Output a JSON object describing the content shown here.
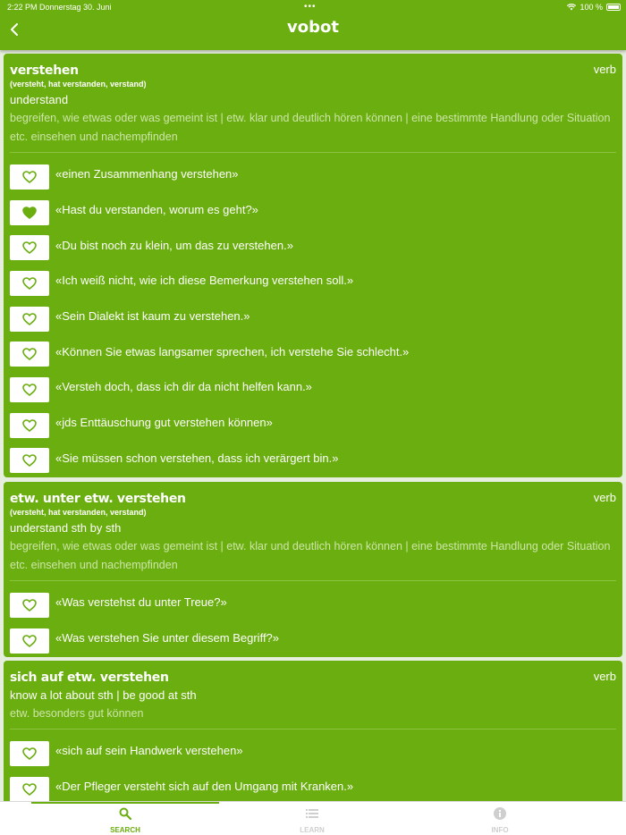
{
  "status": {
    "time": "2:22 PM",
    "date": "Donnerstag 30. Juni",
    "battery": "100 %"
  },
  "nav": {
    "title": "vobot"
  },
  "colors": {
    "accent": "#6aae0f",
    "definition": "#cde5a8",
    "tab_inactive": "#cfcfcf"
  },
  "entries": [
    {
      "word": "verstehen",
      "pos": "verb",
      "forms": "(versteht, hat verstanden, verstand)",
      "translation": "understand",
      "definition": "begreifen, wie etwas oder was gemeint ist | etw. klar und deutlich hören können | eine bestimmte Handlung oder Situation etc. einsehen und nachempfinden",
      "examples": [
        {
          "text": "«einen Zusammenhang verstehen»",
          "liked": false
        },
        {
          "text": "«Hast du verstanden, worum es geht?»",
          "liked": true
        },
        {
          "text": "«Du bist noch zu klein, um das zu verstehen.»",
          "liked": false
        },
        {
          "text": "«Ich weiß nicht, wie ich diese Bemerkung verstehen soll.»",
          "liked": false
        },
        {
          "text": "«Sein Dialekt ist kaum zu verstehen.»",
          "liked": false
        },
        {
          "text": "«Können Sie etwas langsamer sprechen, ich verstehe Sie schlecht.»",
          "liked": false
        },
        {
          "text": "«Versteh doch, dass ich dir da nicht helfen kann.»",
          "liked": false
        },
        {
          "text": "«jds Enttäuschung gut verstehen können»",
          "liked": false
        },
        {
          "text": "«Sie müssen schon verstehen, dass ich verärgert bin.»",
          "liked": false
        }
      ]
    },
    {
      "word": "etw. unter etw. verstehen",
      "pos": "verb",
      "forms": "(versteht, hat verstanden, verstand)",
      "translation": "understand sth by sth",
      "definition": "begreifen, wie etwas oder was gemeint ist | etw. klar und deutlich hören können | eine bestimmte Handlung oder Situation etc. einsehen und nachempfinden",
      "examples": [
        {
          "text": "«Was verstehst du unter Treue?»",
          "liked": false
        },
        {
          "text": "«Was verstehen Sie unter diesem Begriff?»",
          "liked": false
        }
      ]
    },
    {
      "word": "sich auf etw. verstehen",
      "pos": "verb",
      "forms": "",
      "translation": "know a lot about sth | be good at sth",
      "definition": "etw. besonders gut können",
      "examples": [
        {
          "text": "«sich auf sein Handwerk verstehen»",
          "liked": false
        },
        {
          "text": "«Der Pfleger versteht sich auf den Umgang mit Kranken.»",
          "liked": false
        }
      ]
    }
  ],
  "tabs": [
    {
      "label": "SEARCH",
      "icon": "search-icon",
      "active": true
    },
    {
      "label": "LEARN",
      "icon": "list-icon",
      "active": false
    },
    {
      "label": "INFO",
      "icon": "info-icon",
      "active": false
    }
  ]
}
